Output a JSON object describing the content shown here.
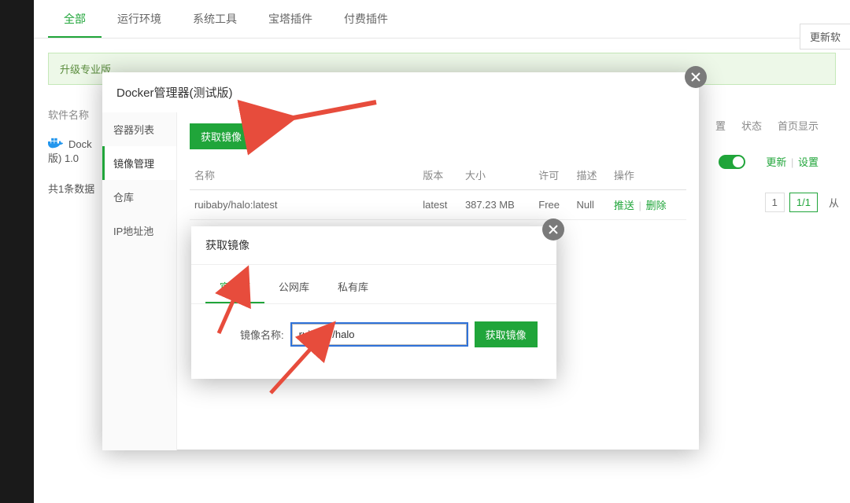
{
  "colors": {
    "accent_green": "#20a53a",
    "arrow_red": "#e74c3c"
  },
  "topTabs": [
    "全部",
    "运行环境",
    "系统工具",
    "宝塔插件",
    "付费插件"
  ],
  "topTabActive": 0,
  "updateBtn": "更新软",
  "upgradeBar": "升级专业版",
  "baseTable": {
    "nameLabel": "软件名称",
    "softRowPrefix": "Dock",
    "softRowSuffix": "版) 1.0",
    "summaryLabel": "共1条数据"
  },
  "pager": {
    "page": "1",
    "pages": "1/1",
    "fromLabel": "从"
  },
  "rightCols": {
    "zhi": "置",
    "status": "状态",
    "home": "首页显示",
    "update": "更新",
    "settings": "设置"
  },
  "modalMain": {
    "title": "Docker管理器(测试版)",
    "side": [
      "容器列表",
      "镜像管理",
      "仓库",
      "IP地址池"
    ],
    "sideActive": 1,
    "getImageBtn": "获取镜像",
    "imgTable": {
      "headers": [
        "名称",
        "版本",
        "大小",
        "许可",
        "描述",
        "操作"
      ],
      "rows": [
        {
          "name": "ruibaby/halo:latest",
          "version": "latest",
          "size": "387.23 MB",
          "license": "Free",
          "desc": "Null",
          "ops": [
            "推送",
            "删除"
          ]
        }
      ]
    }
  },
  "modalInner": {
    "title": "获取镜像",
    "tabs": [
      "官方库",
      "公网库",
      "私有库"
    ],
    "tabActive": 0,
    "fieldLabel": "镜像名称:",
    "fieldValue": "ruibaby/halo",
    "submit": "获取镜像"
  }
}
